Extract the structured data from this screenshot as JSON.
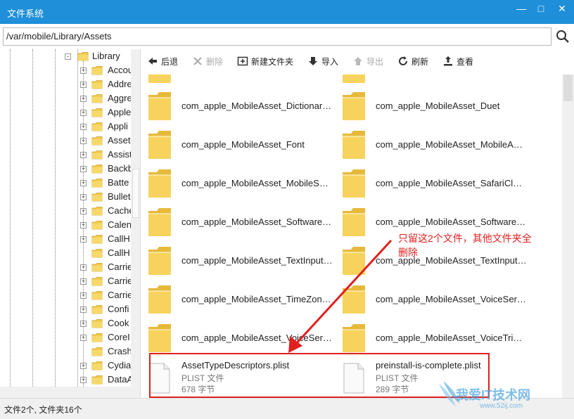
{
  "window": {
    "title": "文件系统",
    "minimize": "—",
    "maximize": "□",
    "close": "✕"
  },
  "address": {
    "path": "/var/mobile/Library/Assets"
  },
  "tree": {
    "root": "Library",
    "items": [
      "Accou",
      "Addre",
      "Aggre",
      "Apple",
      "Appli",
      "Asset",
      "Assist",
      "Backb",
      "Batte",
      "Bullet",
      "Cache",
      "Calen",
      "CallH",
      "CallH",
      "Carrie",
      "Carrie",
      "Carrie",
      "Confi",
      "Cook",
      "CoreI",
      "Crash",
      "Cydia",
      "DataA"
    ]
  },
  "toolbar": {
    "back": "后退",
    "delete": "删除",
    "new_folder": "新建文件夹",
    "import": "导入",
    "export": "导出",
    "refresh": "刷新",
    "view": "查看"
  },
  "folders": {
    "left": [
      "com_apple_MobileAsset_Dictionary...",
      "com_apple_MobileAsset_Font",
      "com_apple_MobileAsset_MobileSoft...",
      "com_apple_MobileAsset_SoftwareU...",
      "com_apple_MobileAsset_TextInput_...",
      "com_apple_MobileAsset_TimeZone...",
      "com_apple_MobileAsset_VoiceServi..."
    ],
    "right": [
      "com_apple_MobileAsset_Duet",
      "com_apple_MobileAsset_MobileAcc...",
      "com_apple_MobileAsset_SafariClou...",
      "com_apple_MobileAsset_SoftwareU...",
      "com_apple_MobileAsset_TextInput_...",
      "com_apple_MobileAsset_VoiceServi...",
      "com_apple_MobileAsset_VoiceTrigg..."
    ]
  },
  "files": [
    {
      "name": "AssetTypeDescriptors.plist",
      "type": "PLIST 文件",
      "size": "678 字节"
    },
    {
      "name": "preinstall-is-complete.plist",
      "type": "PLIST 文件",
      "size": "289 字节"
    }
  ],
  "annotation": {
    "line1": "只留这2个文件，其他文件夹全",
    "line2": "删除"
  },
  "status": "文件2个, 文件夹16个",
  "watermark": {
    "brand": "我爱IT技术网",
    "url": "www.52ij.com"
  },
  "colors": {
    "titlebar": "#1e8fd8",
    "annotation": "#e02020",
    "folder": "#f2c94c"
  }
}
